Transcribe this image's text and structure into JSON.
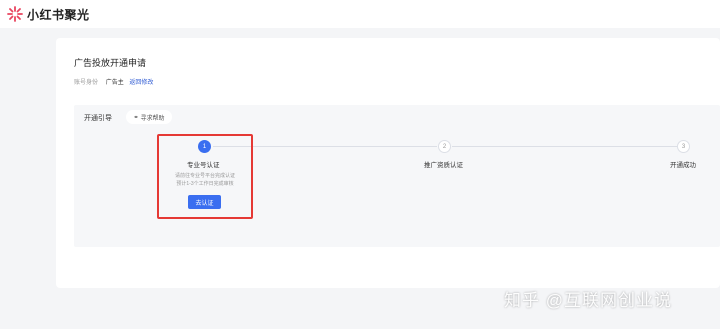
{
  "header": {
    "brand": "小红书聚光",
    "logo_icon": "flower-logo-icon",
    "brand_color": "#e9445f"
  },
  "page": {
    "title": "广告投放开通申请",
    "identity": {
      "label": "账号身份",
      "value": "广告主",
      "change_link": "返回修改"
    }
  },
  "guide": {
    "title": "开通引导",
    "help_button": "寻求帮助",
    "help_icon": "headset-icon"
  },
  "steps": [
    {
      "number": "1",
      "label": "专业号认证",
      "desc_line1": "请前往专业号平台完成认证",
      "desc_line2": "预计1-3个工作日完成审核",
      "button": "去认证",
      "active": true
    },
    {
      "number": "2",
      "label": "推广资质认证",
      "active": false
    },
    {
      "number": "3",
      "label": "开通成功",
      "active": false
    }
  ],
  "colors": {
    "primary": "#3a6ef0",
    "highlight": "#e53935",
    "link": "#2f5bd3"
  },
  "watermark": "知乎 @互联网创业说"
}
